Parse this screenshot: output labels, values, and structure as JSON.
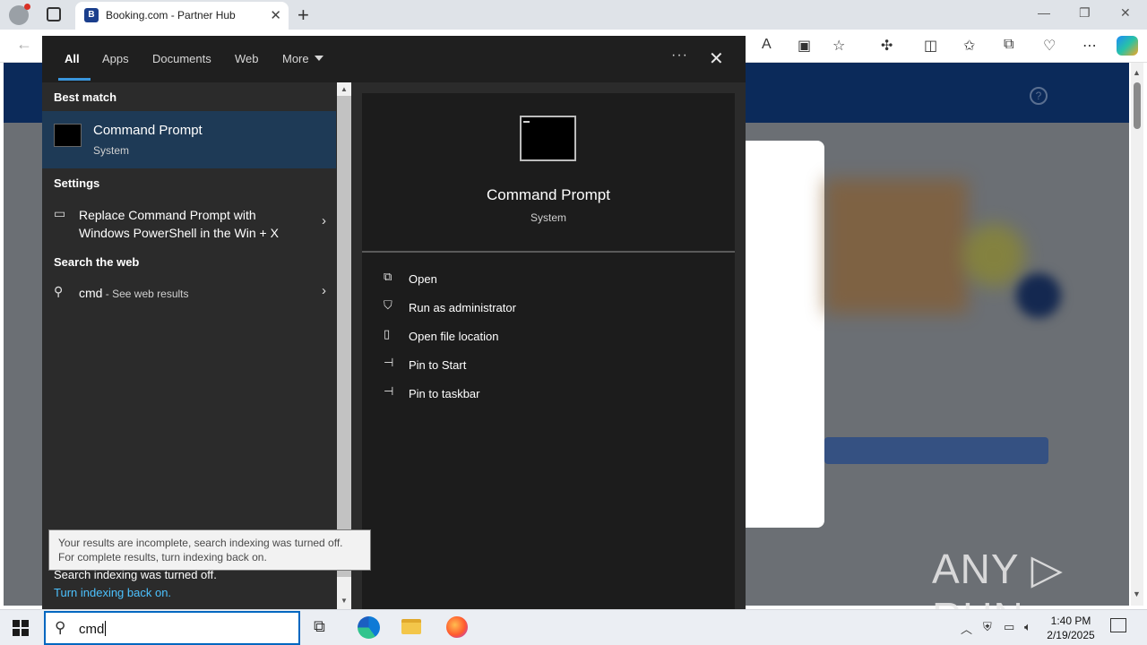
{
  "browser": {
    "tab_title": "Booking.com - Partner Hub",
    "tab_favicon_letter": "B",
    "new_tab_label": "+",
    "close_tab_label": "✕",
    "minimize_label": "—",
    "restore_label": "❐",
    "close_window_label": "✕",
    "toolbar_icons": [
      "read-aloud-icon",
      "immersive-reader-icon",
      "favorite-star-icon",
      "extensions-icon",
      "split-screen-icon",
      "favorites-icon",
      "collections-icon",
      "browser-essentials-icon",
      "more-menu-icon",
      "copilot-icon"
    ]
  },
  "page": {
    "help_label": "?"
  },
  "search_flyout": {
    "tabs": [
      "All",
      "Apps",
      "Documents",
      "Web",
      "More"
    ],
    "more_menu": "···",
    "close": "✕",
    "best_match_header": "Best match",
    "best_match": {
      "title": "Command Prompt",
      "subtitle": "System"
    },
    "settings_header": "Settings",
    "settings_item": {
      "line1": "Replace Command Prompt with",
      "line2": "Windows PowerShell in the Win + X"
    },
    "web_header": "Search the web",
    "web_item": {
      "query": "cmd",
      "suffix": " - See web results"
    },
    "indexing_off": "Search indexing was turned off.",
    "indexing_link": "Turn indexing back on.",
    "tooltip": "Your results are incomplete, search indexing was turned off. For complete results, turn indexing back on.",
    "preview": {
      "title": "Command Prompt",
      "subtitle": "System"
    },
    "actions": [
      "Open",
      "Run as administrator",
      "Open file location",
      "Pin to Start",
      "Pin to taskbar"
    ]
  },
  "taskbar": {
    "search_query": "cmd",
    "time": "1:40 PM",
    "date": "2/19/2025"
  },
  "watermark": "ANY ▷ RUN"
}
